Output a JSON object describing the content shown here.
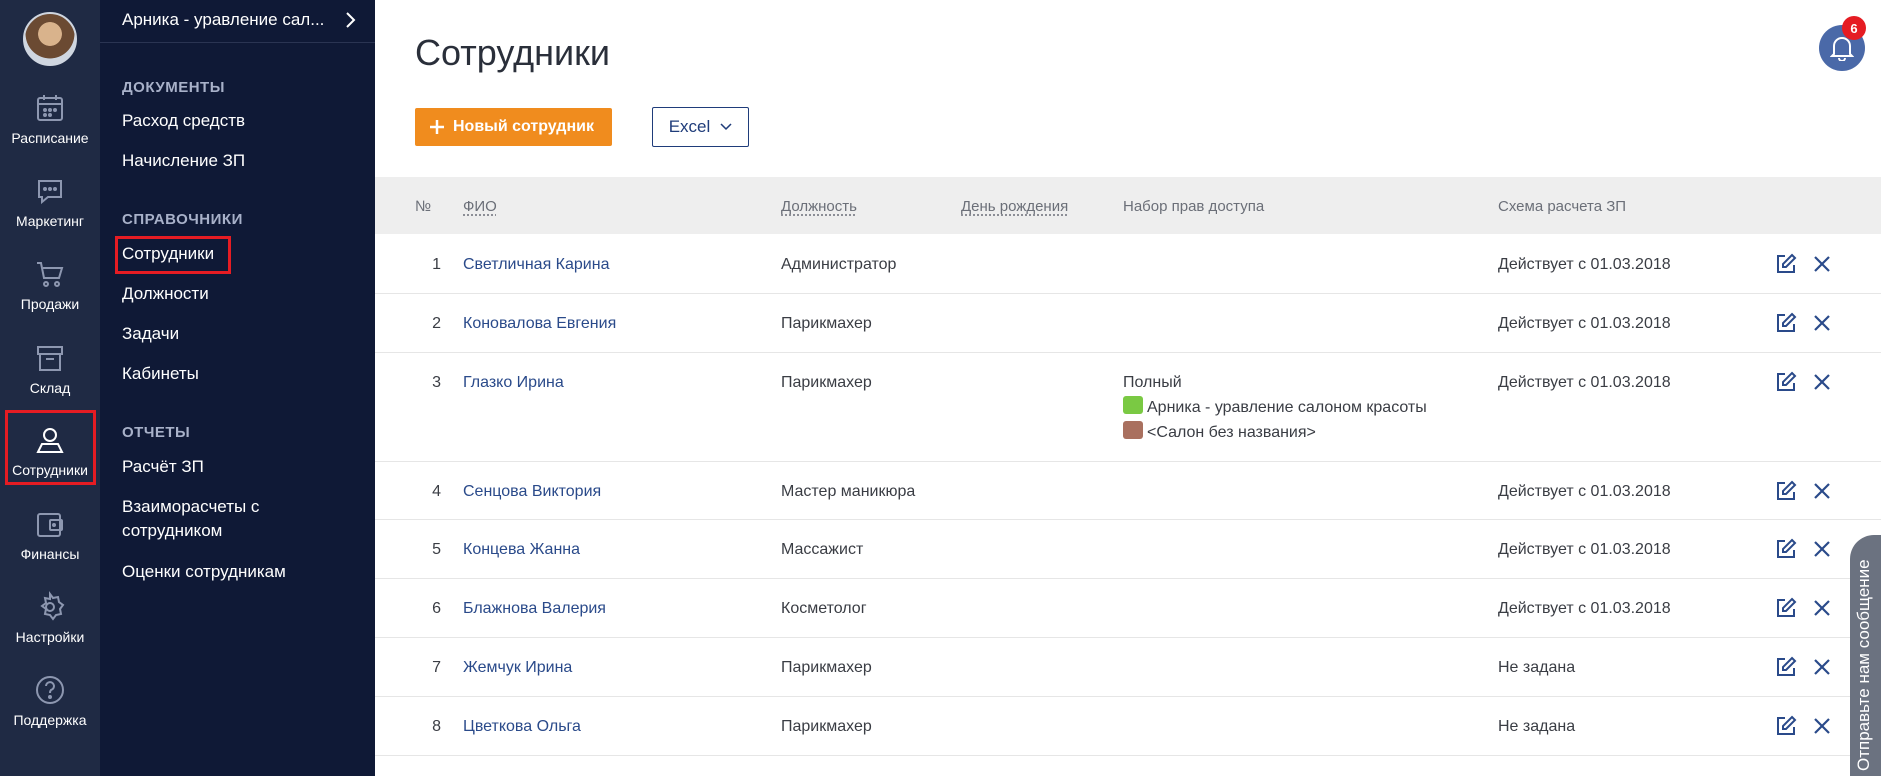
{
  "rail": {
    "items": [
      {
        "label": "Расписание",
        "icon": "calendar-icon"
      },
      {
        "label": "Маркетинг",
        "icon": "chat-icon"
      },
      {
        "label": "Продажи",
        "icon": "cart-icon"
      },
      {
        "label": "Склад",
        "icon": "box-icon"
      },
      {
        "label": "Сотрудники",
        "icon": "user-icon"
      },
      {
        "label": "Финансы",
        "icon": "wallet-icon"
      },
      {
        "label": "Настройки",
        "icon": "gear-icon"
      },
      {
        "label": "Поддержка",
        "icon": "help-icon"
      }
    ]
  },
  "menu": {
    "header": "Арника - уравление сал...",
    "sections": [
      {
        "title": "ДОКУМЕНТЫ",
        "items": [
          "Расход средств",
          "Начисление ЗП"
        ]
      },
      {
        "title": "СПРАВОЧНИКИ",
        "items": [
          "Сотрудники",
          "Должности",
          "Задачи",
          "Кабинеты"
        ]
      },
      {
        "title": "ОТЧЕТЫ",
        "items": [
          "Расчёт ЗП",
          "Взаиморасчеты с сотрудником",
          "Оценки сотрудникам"
        ]
      }
    ]
  },
  "main": {
    "title": "Сотрудники",
    "new_button": "Новый сотрудник",
    "excel_button": "Excel",
    "notifications_count": "6",
    "columns": [
      "№",
      "ФИО",
      "Должность",
      "День рождения",
      "Набор прав доступа",
      "Схема расчета ЗП"
    ],
    "rows": [
      {
        "num": "1",
        "name": "Светличная Карина",
        "position": "Администратор",
        "access": "",
        "scheme": "Действует с 01.03.2018"
      },
      {
        "num": "2",
        "name": "Коновалова Евгения",
        "position": "Парикмахер",
        "access": "",
        "scheme": "Действует с 01.03.2018"
      },
      {
        "num": "3",
        "name": "Глазко Ирина",
        "position": "Парикмахер",
        "access": "Полный",
        "access_salons": [
          {
            "label": "Арника - уравление салоном красоты",
            "color": "#7ac943"
          },
          {
            "label": "<Салон без названия>",
            "color": "#a9705f"
          }
        ],
        "scheme": "Действует с 01.03.2018"
      },
      {
        "num": "4",
        "name": "Сенцова Виктория",
        "position": "Мастер маникюра",
        "access": "",
        "scheme": "Действует с 01.03.2018"
      },
      {
        "num": "5",
        "name": "Концева Жанна",
        "position": "Массажист",
        "access": "",
        "scheme": "Действует с 01.03.2018"
      },
      {
        "num": "6",
        "name": "Блажнова Валерия",
        "position": "Косметолог",
        "access": "",
        "scheme": "Действует с 01.03.2018"
      },
      {
        "num": "7",
        "name": "Жемчук Ирина",
        "position": "Парикмахер",
        "access": "",
        "scheme": "Не задана"
      },
      {
        "num": "8",
        "name": "Цветкова Ольга",
        "position": "Парикмахер",
        "access": "",
        "scheme": "Не задана"
      }
    ]
  },
  "feedback_tab": "Отправьте нам сообщение",
  "colors": {
    "rail": "#1f2a44",
    "menu": "#0f1936",
    "accent": "#f08c1e",
    "link": "#2a4a8a",
    "highlight": "#e51c23"
  }
}
